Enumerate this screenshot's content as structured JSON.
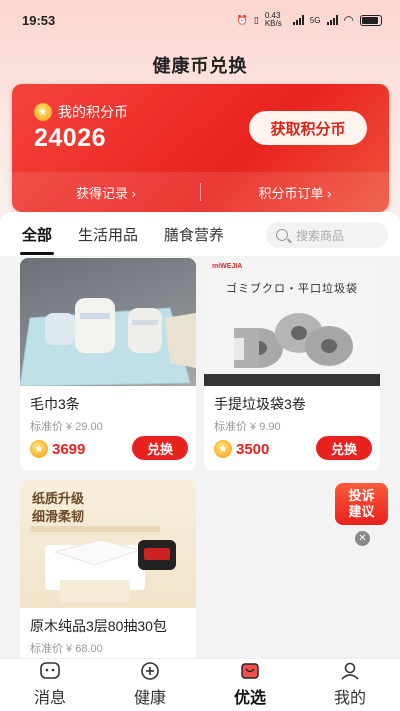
{
  "status": {
    "time": "19:53",
    "speed": "0.43 KB/s",
    "network": "5G"
  },
  "page": {
    "title": "健康币兑换"
  },
  "points_card": {
    "label": "我的积分币",
    "balance": "24026",
    "earn_button": "获取积分币",
    "history_link": "获得记录",
    "orders_link": "积分币订单"
  },
  "tabs": [
    {
      "label": "全部",
      "active": true
    },
    {
      "label": "生活用品",
      "active": false
    },
    {
      "label": "膳食营养",
      "active": false
    }
  ],
  "search": {
    "placeholder": "搜索商品"
  },
  "products": [
    {
      "name": "毛巾3条",
      "standard_price": "标准价 ¥ 29.00",
      "points": "3699",
      "button": "兑换"
    },
    {
      "name": "手提垃圾袋3卷",
      "standard_price": "标准价 ¥ 9.90",
      "points": "3500",
      "button": "兑换",
      "image_text": "ゴミブクロ・平口垃圾袋",
      "brand": "miWEJIA"
    },
    {
      "name": "原木纯品3层80抽30包",
      "standard_price": "标准价 ¥ 68.00",
      "image_text_1": "纸质升级",
      "image_text_2": "细滑柔韧"
    }
  ],
  "fab": {
    "line1": "投诉",
    "line2": "建议"
  },
  "nav": [
    {
      "label": "消息",
      "icon": "message-icon",
      "active": false
    },
    {
      "label": "健康",
      "icon": "plus-circle-icon",
      "active": false
    },
    {
      "label": "优选",
      "icon": "shopping-bag-icon",
      "active": true
    },
    {
      "label": "我的",
      "icon": "profile-icon",
      "active": false
    }
  ],
  "colors": {
    "accent": "#e8231f",
    "card_gradient_start": "#f4433b",
    "coin": "#f4a51c",
    "nav_active": "#f0504a"
  }
}
